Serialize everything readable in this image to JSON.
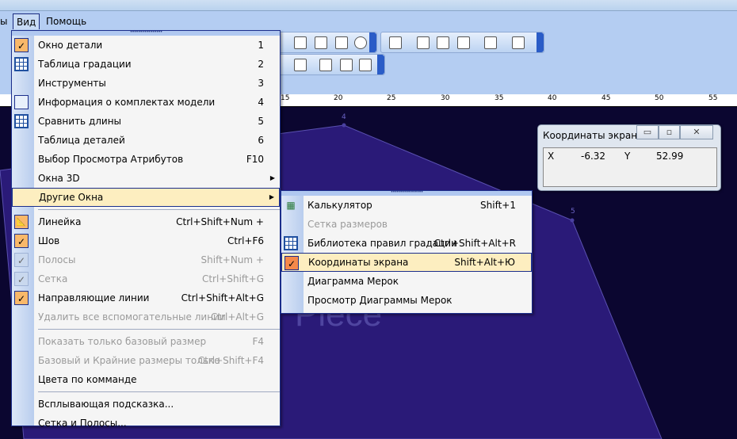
{
  "menubar": {
    "partial": "ы",
    "view": "Вид",
    "help": "Помощь"
  },
  "ruler_ticks": [
    "15",
    "20",
    "25",
    "30",
    "35",
    "40",
    "45",
    "50",
    "55"
  ],
  "canvas": {
    "vertices": [
      "4",
      "5"
    ],
    "watermark": "Piece",
    "fill_color": "#2a1a78",
    "bg_color": "#0b0630"
  },
  "view_menu": {
    "items": [
      {
        "label": "Окно детали",
        "shortcut": "1",
        "icon": "check"
      },
      {
        "label": "Таблица градации",
        "shortcut": "2",
        "icon": "table"
      },
      {
        "label": "Инструменты",
        "shortcut": "3"
      },
      {
        "label": "Информация о комплектах модели",
        "shortcut": "4",
        "icon": "info"
      },
      {
        "label": "Сравнить длины",
        "shortcut": "5",
        "icon": "grid"
      },
      {
        "label": "Таблица деталей",
        "shortcut": "6"
      },
      {
        "label": "Выбор Просмотра Атрибутов",
        "shortcut": "F10"
      },
      {
        "label": "Окна 3D",
        "shortcut": ""
      },
      {
        "label": "Другие Окна",
        "shortcut": ""
      },
      {
        "label": "Линейка",
        "shortcut": "Ctrl+Shift+Num +",
        "icon": "ruler"
      },
      {
        "label": "Шов",
        "shortcut": "Ctrl+F6",
        "icon": "check"
      },
      {
        "label": "Полосы",
        "shortcut": "Shift+Num +",
        "icon": "check-disabled"
      },
      {
        "label": "Сетка",
        "shortcut": "Ctrl+Shift+G",
        "icon": "check-disabled"
      },
      {
        "label": "Направляющие  линии",
        "shortcut": "Ctrl+Shift+Alt+G",
        "icon": "check"
      },
      {
        "label": "Удалить все вспомогательные линии",
        "shortcut": "Ctrl+Alt+G"
      },
      {
        "label": "Показать только базовый размер",
        "shortcut": "F4"
      },
      {
        "label": "Базовый и Крайние размеры только",
        "shortcut": "Ctrl+Shift+F4"
      },
      {
        "label": "Цвета по комманде",
        "shortcut": ""
      },
      {
        "label": "Всплывающая подсказка...",
        "shortcut": ""
      },
      {
        "label": "Сетка и Полосы...",
        "shortcut": ""
      }
    ]
  },
  "sub_menu": {
    "items": [
      {
        "label": "Калькулятор",
        "shortcut": "Shift+1",
        "icon": "calculator"
      },
      {
        "label": "Сетка размеров",
        "shortcut": ""
      },
      {
        "label": "Библиотека правил градации",
        "shortcut": "Ctrl+Shift+Alt+R",
        "icon": "grid"
      },
      {
        "label": "Координаты экрана",
        "shortcut": "Shift+Alt+Ю",
        "icon": "check"
      },
      {
        "label": "Диаграмма Мерок",
        "shortcut": ""
      },
      {
        "label": "Просмотр Диаграммы Мерок",
        "shortcut": ""
      }
    ]
  },
  "coord_window": {
    "title": "Координаты экрана",
    "x_label": "X",
    "x_value": "-6.32",
    "y_label": "Y",
    "y_value": "52.99"
  }
}
